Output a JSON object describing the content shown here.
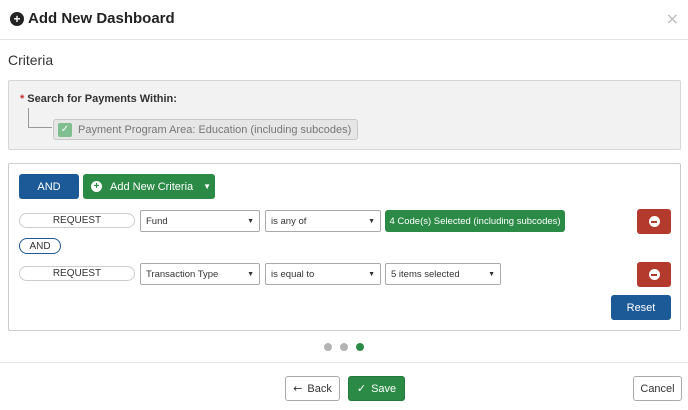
{
  "header": {
    "title": "Add New Dashboard",
    "title_icon": "plus-circle-icon",
    "close_icon": "close-icon",
    "close_glyph": "×"
  },
  "criteria_section": {
    "title": "Criteria"
  },
  "scope": {
    "required_marker": "*",
    "label": "Search for Payments Within:",
    "chip_label": "Payment Program Area: Education (including subcodes)",
    "chip_icon": "checkbox-checked-icon"
  },
  "builder": {
    "and_label": "AND",
    "add_criteria_label": "Add New Criteria",
    "rows": [
      {
        "request_label": "REQUEST",
        "field": "Fund",
        "operator": "is any of",
        "value": "4 Code(s) Selected (including subcodes)"
      },
      {
        "request_label": "REQUEST",
        "field": "Transaction Type",
        "operator": "is equal to",
        "value": "5 items selected"
      }
    ],
    "connector_label": "AND",
    "reset_label": "Reset"
  },
  "pager": {
    "total": 3,
    "active": 3
  },
  "footer": {
    "back_label": "Back",
    "save_label": "Save",
    "cancel_label": "Cancel"
  },
  "colors": {
    "primary_blue": "#1b5a96",
    "success_green": "#2a8a46",
    "danger_red": "#b43a2e",
    "dot_inactive": "#b3b3b3"
  }
}
